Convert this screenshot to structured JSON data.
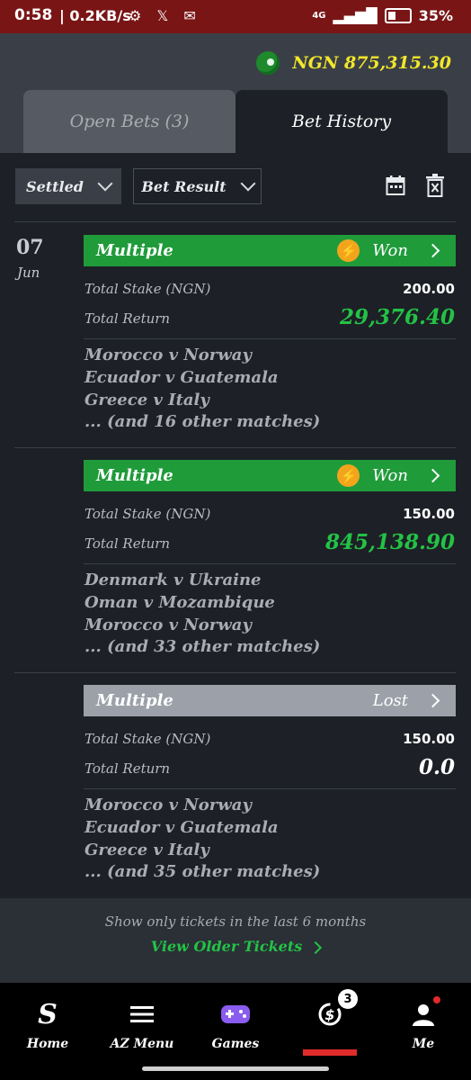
{
  "status_bar": {
    "time": "0:58",
    "net_speed": "| 0.2KB/s",
    "network": "4G",
    "battery": "35%"
  },
  "balance": {
    "currency": "NGN",
    "amount": "875,315.30"
  },
  "tabs": [
    {
      "label": "Open Bets (3)",
      "active": false
    },
    {
      "label": "Bet History",
      "active": true
    }
  ],
  "filters": {
    "status": "Settled",
    "result": "Bet Result"
  },
  "date": {
    "day": "07",
    "month": "Jun"
  },
  "labels": {
    "total_stake": "Total Stake (NGN)",
    "total_return": "Total Return"
  },
  "bets": [
    {
      "type": "Multiple",
      "result": "Won",
      "stake": "200.00",
      "return": "29,376.40",
      "matches": [
        "Morocco v Norway",
        "Ecuador v Guatemala",
        "Greece v Italy"
      ],
      "more": "... (and 16 other matches)"
    },
    {
      "type": "Multiple",
      "result": "Won",
      "stake": "150.00",
      "return": "845,138.90",
      "matches": [
        "Denmark v Ukraine",
        "Oman v Mozambique",
        "Morocco v Norway"
      ],
      "more": "... (and 33 other matches)"
    },
    {
      "type": "Multiple",
      "result": "Lost",
      "stake": "150.00",
      "return": "0.0",
      "matches": [
        "Morocco v Norway",
        "Ecuador v Guatemala",
        "Greece v Italy"
      ],
      "more": "... (and 35 other matches)"
    }
  ],
  "footer": {
    "note": "Show only tickets in the last 6 months",
    "link": "View Older Tickets"
  },
  "nav": [
    {
      "label": "Home",
      "icon": "sporty-logo-icon"
    },
    {
      "label": "AZ Menu",
      "icon": "menu-icon"
    },
    {
      "label": "Games",
      "icon": "gamepad-icon"
    },
    {
      "label": "",
      "icon": "bets-icon",
      "badge": "3"
    },
    {
      "label": "Me",
      "icon": "user-icon"
    }
  ],
  "colors": {
    "won": "#1f9b3a",
    "lost": "#9ca0a8",
    "balance": "#f2e72a",
    "status_bar": "#7a1516"
  }
}
